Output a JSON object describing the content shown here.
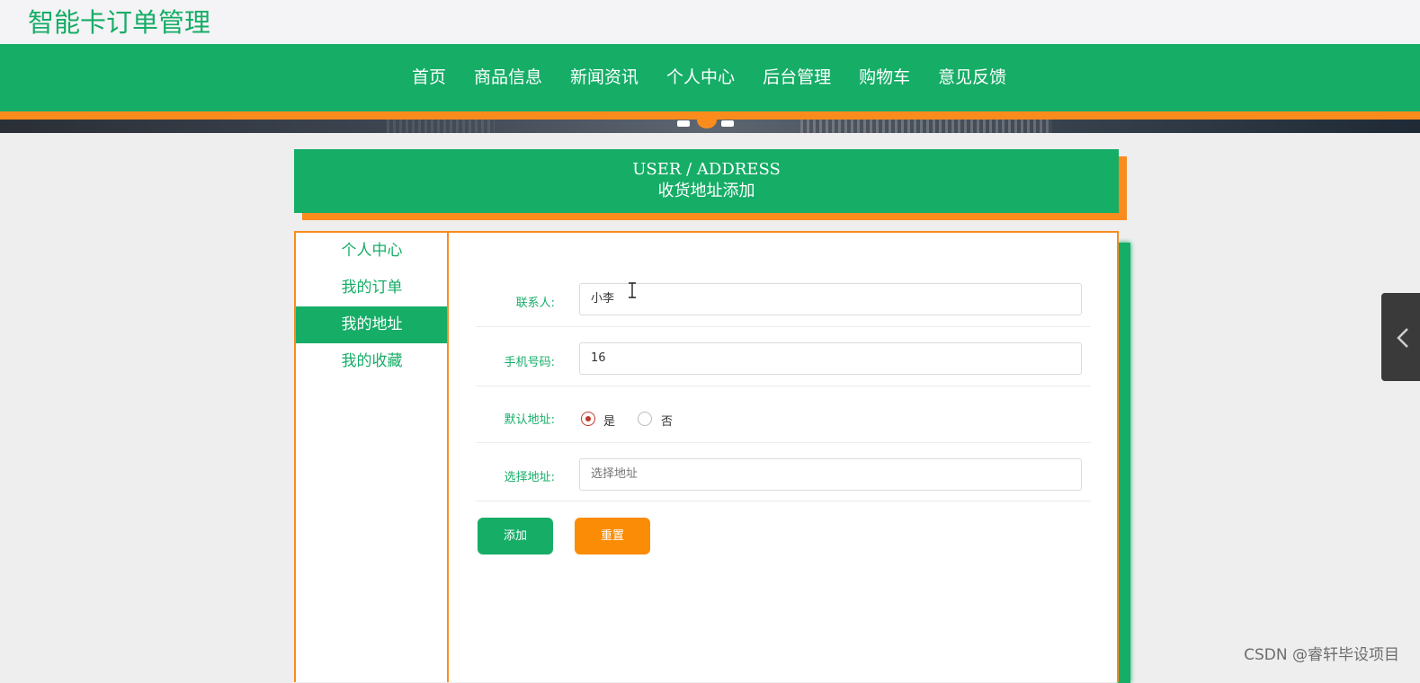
{
  "site": {
    "title": "智能卡订单管理"
  },
  "nav": {
    "items": [
      "首页",
      "商品信息",
      "新闻资讯",
      "个人中心",
      "后台管理",
      "购物车",
      "意见反馈"
    ]
  },
  "page_header": {
    "en": "USER / ADDRESS",
    "cn": "收货地址添加"
  },
  "sidebar": {
    "items": [
      "个人中心",
      "我的订单",
      "我的地址",
      "我的收藏"
    ],
    "active": "我的地址"
  },
  "form": {
    "contact_label": "联系人:",
    "contact_value": "小李",
    "phone_label": "手机号码:",
    "phone_value": "16",
    "default_label": "默认地址:",
    "default_yes": "是",
    "default_no": "否",
    "default_selected": "是",
    "address_label": "选择地址:",
    "address_placeholder": "选择地址",
    "add_button": "添加",
    "reset_button": "重置"
  },
  "watermark": "CSDN @睿轩毕设项目",
  "colors": {
    "primary": "#16ad67",
    "accent": "#fa8c1e"
  },
  "icons": [
    "chevron-left-icon",
    "text-cursor-icon"
  ]
}
